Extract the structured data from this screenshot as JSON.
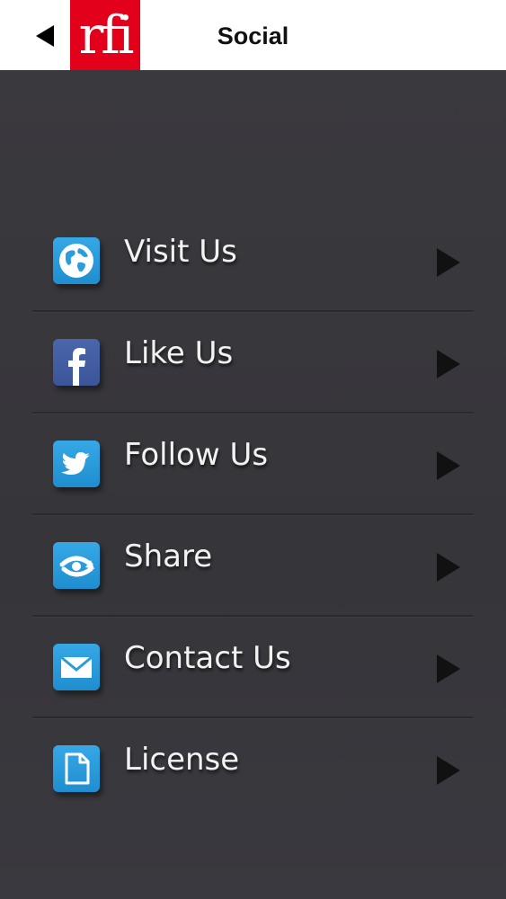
{
  "header": {
    "logo_text": "rfi",
    "title": "Social",
    "logo_color": "#e2001a"
  },
  "menu": {
    "items": [
      {
        "label": "Visit Us",
        "icon": "globe-icon"
      },
      {
        "label": "Like Us",
        "icon": "facebook-icon"
      },
      {
        "label": "Follow Us",
        "icon": "twitter-icon"
      },
      {
        "label": "Share",
        "icon": "share-icon"
      },
      {
        "label": "Contact Us",
        "icon": "mail-icon"
      },
      {
        "label": "License",
        "icon": "document-icon"
      }
    ]
  },
  "colors": {
    "background": "#38373c",
    "header_bg": "#ffffff",
    "icon_blue": "#2b9cdc",
    "facebook_blue": "#3b5598",
    "text": "#f2f2f2"
  }
}
